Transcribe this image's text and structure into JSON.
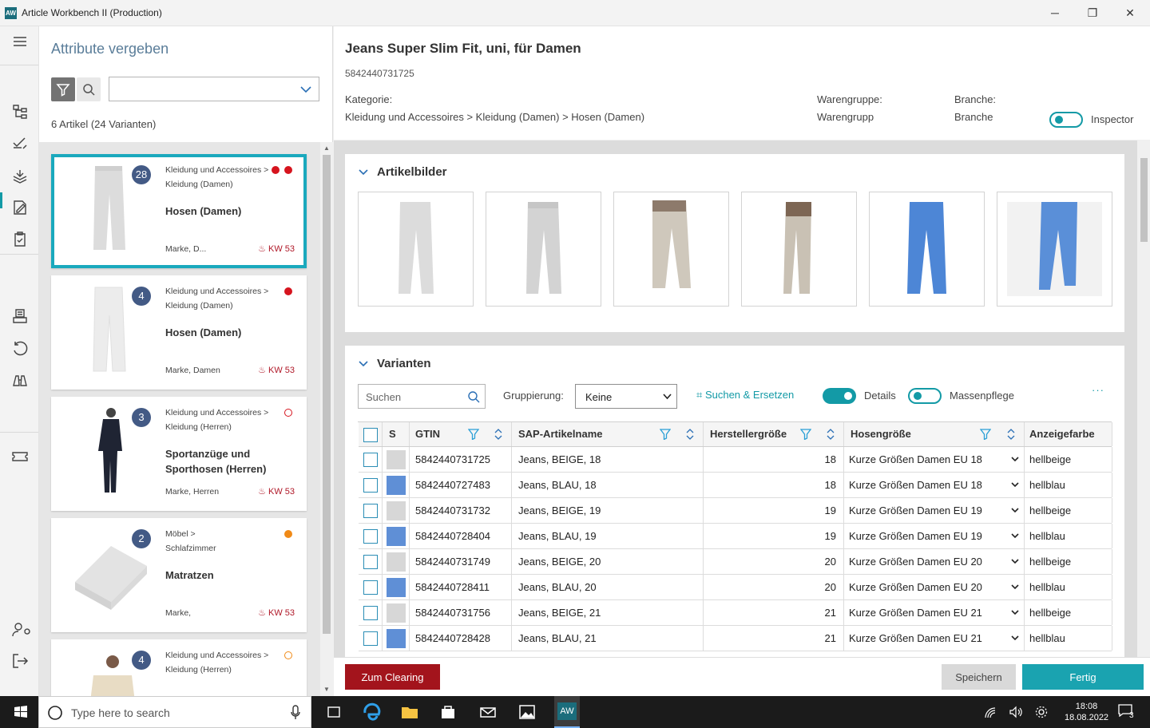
{
  "window": {
    "app_icon_text": "AW",
    "title": "Article Workbench II (Production)",
    "minimize": "─",
    "maximize": "❐",
    "close": "✕"
  },
  "left": {
    "title": "Attribute vergeben",
    "count": "6 Artikel (24 Varianten)",
    "cards": [
      {
        "count": "28",
        "cat1": "Kleidung und Accessoires >",
        "cat2": "Kleidung (Damen)",
        "name": "Hosen (Damen)",
        "marke": "Marke, D...",
        "kw": "KW 53",
        "dots": [
          "#d6141e",
          "#d6141e"
        ],
        "dot_style": "filled"
      },
      {
        "count": "4",
        "cat1": "Kleidung und Accessoires >",
        "cat2": "Kleidung (Damen)",
        "name": "Hosen (Damen)",
        "marke": "Marke, Damen",
        "kw": "KW 53",
        "dots": [
          "#d6141e"
        ],
        "dot_style": "filled"
      },
      {
        "count": "3",
        "cat1": "Kleidung und Accessoires >",
        "cat2": "Kleidung (Herren)",
        "name": "Sportanzüge und Sporthosen (Herren)",
        "marke": "Marke, Herren",
        "kw": "KW 53",
        "dots": [
          "#d6141e"
        ],
        "dot_style": "outline"
      },
      {
        "count": "2",
        "cat1": "Möbel >",
        "cat2": "Schlafzimmer",
        "name": "Matratzen",
        "marke": "Marke,",
        "kw": "KW 53",
        "dots": [
          "#f08a17"
        ],
        "dot_style": "filled"
      },
      {
        "count": "4",
        "cat1": "Kleidung und Accessoires >",
        "cat2": "Kleidung (Herren)",
        "name": "",
        "marke": "",
        "kw": "",
        "dots": [
          "#f08a17"
        ],
        "dot_style": "outline"
      }
    ]
  },
  "header": {
    "title": "Jeans Super Slim Fit, uni, für Damen",
    "gtin": "5842440731725",
    "kategorie_label": "Kategorie:",
    "kategorie_value": "Kleidung und Accessoires > Kleidung (Damen) > Hosen (Damen)",
    "warengruppe_label": "Warengruppe:",
    "warengruppe_value": "Warengrupp",
    "branche_label": "Branche:",
    "branche_value": "Branche",
    "inspector_label": "Inspector"
  },
  "bilder": {
    "title": "Artikelbilder",
    "images": [
      "beige-front",
      "beige-back",
      "beige-model",
      "beige-side",
      "blue-front",
      "blue-model"
    ]
  },
  "varianten": {
    "title": "Varianten",
    "search_placeholder": "Suchen",
    "grouping_label": "Gruppierung:",
    "grouping_value": "Keine",
    "search_replace": "Suchen & Ersetzen",
    "details_label": "Details",
    "massenpflege_label": "Massenpflege",
    "more": "···",
    "columns": [
      "S",
      "GTIN",
      "SAP-Artikelname",
      "Herstellergröße",
      "Hosengröße",
      "Anzeigefarbe"
    ],
    "rows": [
      {
        "color": "#d7d7d7",
        "gtin": "5842440731725",
        "name": "Jeans, BEIGE, 18",
        "size": "18",
        "hose": "Kurze Größen Damen EU 18",
        "farbe": "hellbeige"
      },
      {
        "color": "#5f8fd6",
        "gtin": "5842440727483",
        "name": "Jeans, BLAU, 18",
        "size": "18",
        "hose": "Kurze Größen Damen EU 18",
        "farbe": "hellblau"
      },
      {
        "color": "#d7d7d7",
        "gtin": "5842440731732",
        "name": "Jeans, BEIGE, 19",
        "size": "19",
        "hose": "Kurze Größen Damen EU 19",
        "farbe": "hellbeige"
      },
      {
        "color": "#5f8fd6",
        "gtin": "5842440728404",
        "name": "Jeans, BLAU, 19",
        "size": "19",
        "hose": "Kurze Größen Damen EU 19",
        "farbe": "hellblau"
      },
      {
        "color": "#d7d7d7",
        "gtin": "5842440731749",
        "name": "Jeans, BEIGE, 20",
        "size": "20",
        "hose": "Kurze Größen Damen EU 20",
        "farbe": "hellbeige"
      },
      {
        "color": "#5f8fd6",
        "gtin": "5842440728411",
        "name": "Jeans, BLAU, 20",
        "size": "20",
        "hose": "Kurze Größen Damen EU 20",
        "farbe": "hellblau"
      },
      {
        "color": "#d7d7d7",
        "gtin": "5842440731756",
        "name": "Jeans, BEIGE, 21",
        "size": "21",
        "hose": "Kurze Größen Damen EU 21",
        "farbe": "hellbeige"
      },
      {
        "color": "#5f8fd6",
        "gtin": "5842440728428",
        "name": "Jeans, BLAU, 21",
        "size": "21",
        "hose": "Kurze Größen Damen EU 21",
        "farbe": "hellblau"
      }
    ]
  },
  "footer": {
    "clearing": "Zum Clearing",
    "save": "Speichern",
    "done": "Fertig"
  },
  "taskbar": {
    "search_placeholder": "Type here to search",
    "aw_label": "AW",
    "time": "18:08",
    "date": "18.08.2022",
    "notification_count": "3"
  },
  "colors": {
    "accent": "#139aa6",
    "danger": "#a3141c",
    "badge": "#435a85"
  }
}
